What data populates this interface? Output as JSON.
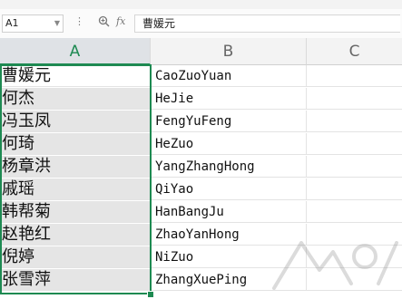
{
  "formula_bar": {
    "name_box": "A1",
    "zoom_icon": "magnifier-zoom-icon",
    "fx_label": "fx",
    "formula_value": "曹媛元"
  },
  "columns": [
    "A",
    "B",
    "C"
  ],
  "selected_column": "A",
  "rows": [
    {
      "a": "曹媛元",
      "b": "CaoZuoYuan"
    },
    {
      "a": "何杰",
      "b": "HeJie"
    },
    {
      "a": "冯玉凤",
      "b": "FengYuFeng"
    },
    {
      "a": "何琦",
      "b": "HeZuo"
    },
    {
      "a": "杨章洪",
      "b": "YangZhangHong"
    },
    {
      "a": "戚瑶",
      "b": "QiYao"
    },
    {
      "a": "韩帮菊",
      "b": "HanBangJu"
    },
    {
      "a": "赵艳红",
      "b": "ZhaoYanHong"
    },
    {
      "a": "倪婷",
      "b": "NiZuo"
    },
    {
      "a": "张雪萍",
      "b": "ZhangXuePing"
    }
  ],
  "colors": {
    "selection": "#1e8a52",
    "selected_fill": "#e5e5e5",
    "header_bg": "#f3f3f3"
  }
}
